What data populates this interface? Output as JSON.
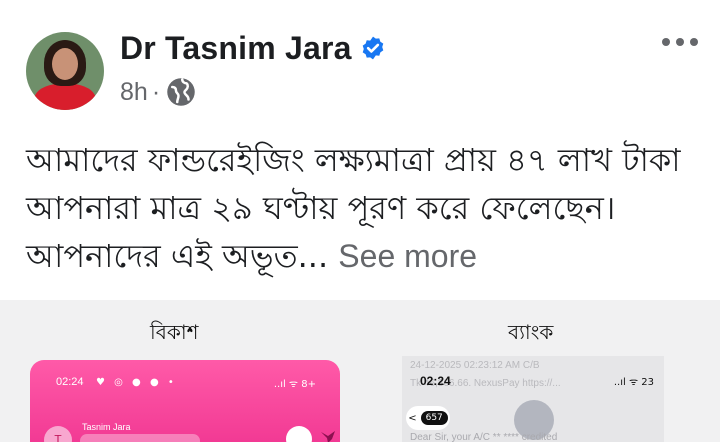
{
  "post": {
    "author": "Dr Tasnim Jara",
    "verified": true,
    "time": "8h",
    "separator": "·",
    "audience_icon": "globe-icon",
    "more_icon": "more-horizontal-icon",
    "text": "আমাদের ফান্ডরেইজিং লক্ষ্যমাত্রা প্রায় ৪৭ লাখ টাকা আপনারা মাত্র ২৯ ঘণ্টায় পূরণ করে ফেলেছেন। আপনাদের এই অভূত...",
    "see_more": "See more"
  },
  "media": {
    "left_label": "বিকাশ",
    "right_label": "ব্যাংক",
    "bkash": {
      "time": "02:24",
      "icons": "♥ ◎ ● ● •",
      "status": "..ıl ᯤ 8+",
      "account_name": "Tasnim Jara",
      "avatar_letter": "T"
    },
    "bank": {
      "ghost_line_1": "24-12-2025 02:23:12 AM C/B",
      "ghost_line_2": "Tk 46,366.66. NexusPay https://...",
      "time": "02:24",
      "status": "..ıl ᯤ 23",
      "back_label": "<",
      "back_count": "657",
      "ghost_line_3": "Dear Sir, your A/C ** **** credited"
    }
  },
  "colors": {
    "verified_blue": "#1877f2",
    "bkash_pink": "#f23a94",
    "secondary_text": "#65676b"
  }
}
